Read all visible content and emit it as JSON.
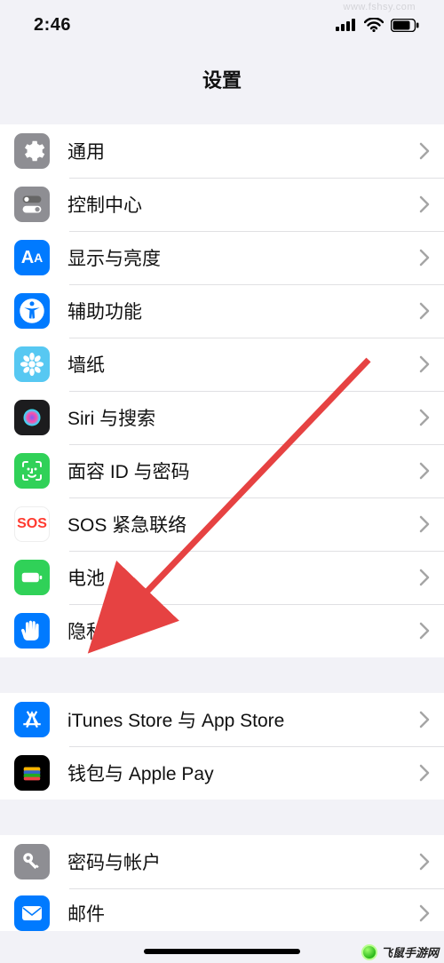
{
  "status": {
    "time": "2:46"
  },
  "nav": {
    "title": "设置"
  },
  "groups": [
    {
      "id": "g1",
      "items": [
        {
          "id": "general",
          "label": "通用",
          "icon": "gear-icon",
          "bg": "bg-gray"
        },
        {
          "id": "control-center",
          "label": "控制中心",
          "icon": "switch-icon",
          "bg": "bg-gray"
        },
        {
          "id": "display",
          "label": "显示与亮度",
          "icon": "aa-icon",
          "bg": "bg-blue"
        },
        {
          "id": "accessibility",
          "label": "辅助功能",
          "icon": "accessibility-icon",
          "bg": "bg-blue"
        },
        {
          "id": "wallpaper",
          "label": "墙纸",
          "icon": "flower-icon",
          "bg": "bg-cyan"
        },
        {
          "id": "siri",
          "label": "Siri 与搜索",
          "icon": "siri-icon",
          "bg": "bg-black"
        },
        {
          "id": "faceid",
          "label": "面容 ID 与密码",
          "icon": "faceid-icon",
          "bg": "bg-green"
        },
        {
          "id": "sos",
          "label": "SOS 紧急联络",
          "icon": "sos-icon",
          "bg": "bg-white"
        },
        {
          "id": "battery",
          "label": "电池",
          "icon": "battery-icon",
          "bg": "bg-green"
        },
        {
          "id": "privacy",
          "label": "隐私",
          "icon": "hand-icon",
          "bg": "bg-blue"
        }
      ]
    },
    {
      "id": "g2",
      "items": [
        {
          "id": "itunes",
          "label": "iTunes Store 与 App Store",
          "icon": "appstore-icon",
          "bg": "bg-blue"
        },
        {
          "id": "wallet",
          "label": "钱包与 Apple Pay",
          "icon": "wallet-icon",
          "bg": "bg-orange"
        }
      ]
    },
    {
      "id": "g3",
      "items": [
        {
          "id": "accounts",
          "label": "密码与帐户",
          "icon": "key-icon",
          "bg": "bg-gray"
        },
        {
          "id": "mail",
          "label": "邮件",
          "icon": "mail-icon",
          "bg": "bg-blue"
        }
      ]
    }
  ],
  "annotation": {
    "arrow_target": "privacy"
  },
  "watermark": {
    "text": "飞鼠手游网",
    "faint_url": "www.fshsy.com"
  }
}
